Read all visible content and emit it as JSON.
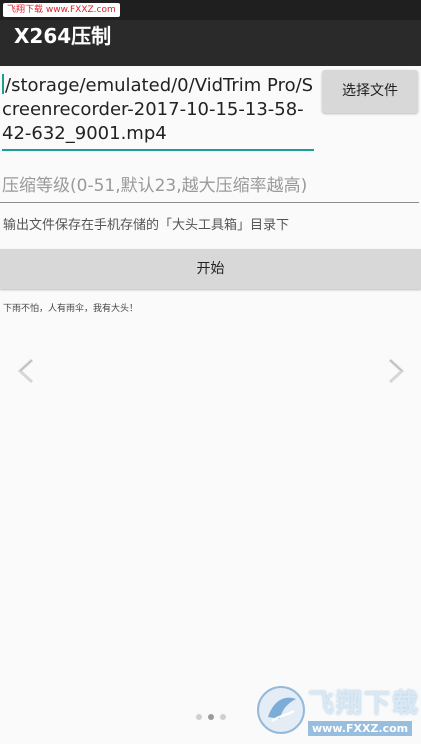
{
  "status_bar": {
    "watermark": "飞翔下载 www.FXXZ.com"
  },
  "toolbar": {
    "title": "X264压制"
  },
  "file": {
    "path": "/storage/emulated/0/VidTrim Pro/Screenrecorder-2017-10-15-13-58-42-632_9001.mp4",
    "choose_label": "选择文件"
  },
  "compression": {
    "placeholder": "压缩等级(0-51,默认23,越大压缩率越高)",
    "value": ""
  },
  "output_hint": "输出文件保存在手机存储的「大头工具箱」目录下",
  "start_label": "开始",
  "slogan": "下雨不怕，人有雨伞，我有大头！",
  "carousel": {
    "dots": 3,
    "active_index": 1
  },
  "watermark_bottom": {
    "name": "飞翔下载",
    "url": "www.FXXZ.com"
  },
  "colors": {
    "accent": "#1a9e95",
    "toolbar": "#2a2a2a",
    "button": "#d8d8d8"
  }
}
